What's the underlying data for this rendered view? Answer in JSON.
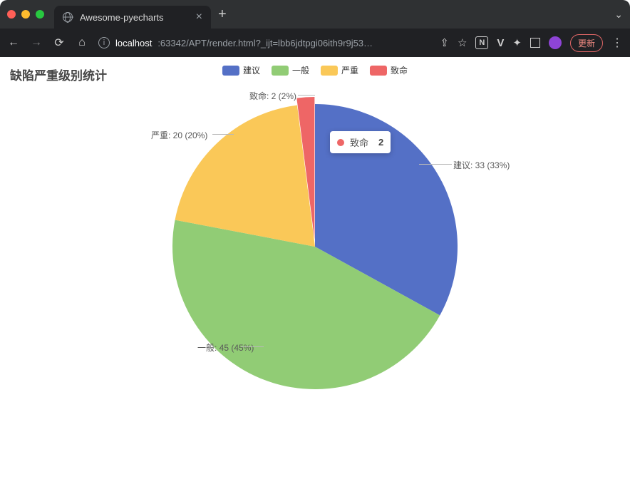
{
  "browser": {
    "tab_title": "Awesome-pyecharts",
    "new_tab_glyph": "+",
    "close_glyph": "×",
    "window_ctrl_glyph": "⌄",
    "nav": {
      "back": "←",
      "forward": "→",
      "reload": "⟳",
      "home": "⌂"
    },
    "address_host": "localhost",
    "address_path": ":63342/APT/render.html?_ijt=lbb6jdtpgi06ith9r9j53…",
    "right_icons": {
      "share": "⇪",
      "star": "☆",
      "notion_letter": "N",
      "vue": "V",
      "puzzle": "✦",
      "panel": "◧",
      "update_label": "更新",
      "kebab": "⋮"
    }
  },
  "chart_data": {
    "type": "pie",
    "title": "缺陷严重级别统计",
    "series": [
      {
        "name": "建议",
        "value": 33,
        "percent": 33,
        "color": "#5470c6"
      },
      {
        "name": "一般",
        "value": 45,
        "percent": 45,
        "color": "#91cc75"
      },
      {
        "name": "严重",
        "value": 20,
        "percent": 20,
        "color": "#fac858"
      },
      {
        "name": "致命",
        "value": 2,
        "percent": 2,
        "color": "#ee6666"
      }
    ],
    "legend_position": "top-center",
    "label_format": "{name}: {value} ({percent}%)"
  },
  "tooltip": {
    "name": "致命",
    "value": "2",
    "color": "#ee6666"
  },
  "labels": {
    "建议": "建议: 33 (33%)",
    "一般": "一般: 45 (45%)",
    "严重": "严重: 20 (20%)",
    "致命": "致命: 2 (2%)"
  }
}
